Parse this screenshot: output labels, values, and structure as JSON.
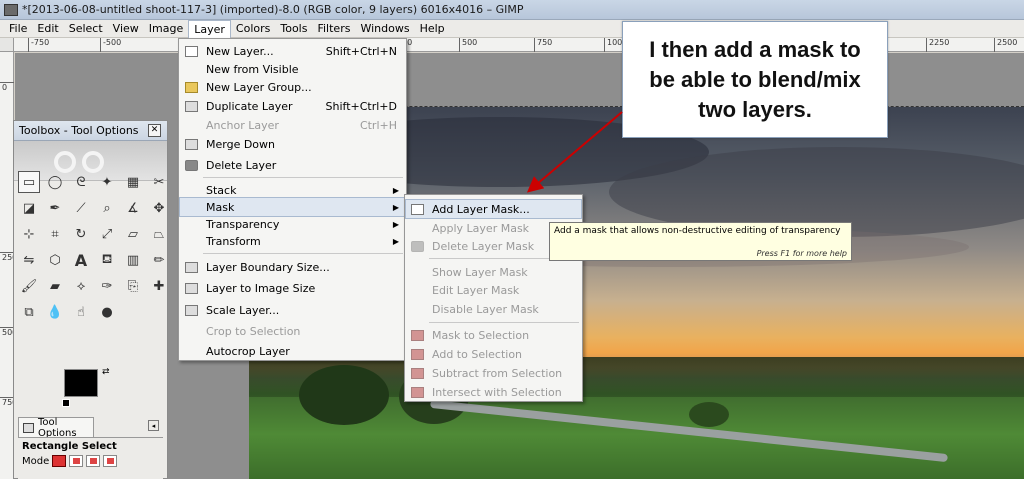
{
  "window": {
    "title": "*[2013-06-08-untitled shoot-117-3] (imported)-8.0 (RGB color, 9 layers) 6016x4016 – GIMP"
  },
  "menubar": [
    "File",
    "Edit",
    "Select",
    "View",
    "Image",
    "Layer",
    "Colors",
    "Tools",
    "Filters",
    "Windows",
    "Help"
  ],
  "ruler": {
    "top": [
      "-750",
      "-500",
      "250",
      "500",
      "750",
      "1000",
      "2250",
      "2500"
    ],
    "left": [
      "0",
      "250",
      "500",
      "750"
    ]
  },
  "toolbox": {
    "title": "Toolbox - Tool Options",
    "options_tab": "Tool Options",
    "tool_name": "Rectangle Select",
    "mode_label": "Mode"
  },
  "layer_menu": [
    {
      "label": "New Layer...",
      "accel": "Shift+Ctrl+N",
      "disabled": false
    },
    {
      "label": "New from Visible",
      "accel": "",
      "disabled": false
    },
    {
      "label": "New Layer Group...",
      "accel": "",
      "disabled": false
    },
    {
      "label": "Duplicate Layer",
      "accel": "Shift+Ctrl+D",
      "disabled": false
    },
    {
      "label": "Anchor Layer",
      "accel": "Ctrl+H",
      "disabled": true
    },
    {
      "label": "Merge Down",
      "accel": "",
      "disabled": false
    },
    {
      "label": "Delete Layer",
      "accel": "",
      "disabled": false
    },
    {
      "label": "Stack",
      "accel": "",
      "disabled": false
    },
    {
      "label": "Mask",
      "accel": "",
      "disabled": false
    },
    {
      "label": "Transparency",
      "accel": "",
      "disabled": false
    },
    {
      "label": "Transform",
      "accel": "",
      "disabled": false
    },
    {
      "label": "Layer Boundary Size...",
      "accel": "",
      "disabled": false
    },
    {
      "label": "Layer to Image Size",
      "accel": "",
      "disabled": false
    },
    {
      "label": "Scale Layer...",
      "accel": "",
      "disabled": false
    },
    {
      "label": "Crop to Selection",
      "accel": "",
      "disabled": true
    },
    {
      "label": "Autocrop Layer",
      "accel": "",
      "disabled": false
    }
  ],
  "mask_menu": [
    {
      "label": "Add Layer Mask...",
      "disabled": false
    },
    {
      "label": "Apply Layer Mask",
      "disabled": true
    },
    {
      "label": "Delete Layer Mask",
      "disabled": true
    },
    {
      "label": "Show Layer Mask",
      "disabled": true
    },
    {
      "label": "Edit Layer Mask",
      "disabled": true
    },
    {
      "label": "Disable Layer Mask",
      "disabled": true
    },
    {
      "label": "Mask to Selection",
      "disabled": true
    },
    {
      "label": "Add to Selection",
      "disabled": true
    },
    {
      "label": "Subtract from Selection",
      "disabled": true
    },
    {
      "label": "Intersect with Selection",
      "disabled": true
    }
  ],
  "tooltip": {
    "text": "Add a mask that allows non-destructive editing of transparency",
    "hint": "Press F1 for more help"
  },
  "callout": {
    "text": "I then add a mask to be able to blend/mix two layers."
  },
  "colors": {
    "annotation_arrow": "#cc0000",
    "highlight": "#dfe7f1"
  }
}
